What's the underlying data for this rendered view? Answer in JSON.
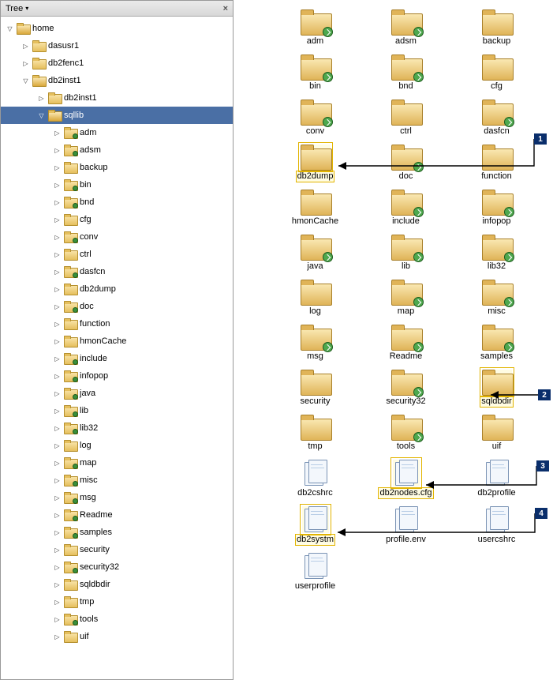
{
  "panel": {
    "title": "Tree"
  },
  "tree": [
    {
      "depth": 0,
      "toggle": "open",
      "folder": "open",
      "label": "home"
    },
    {
      "depth": 1,
      "toggle": "closed",
      "folder": "closed",
      "label": "dasusr1"
    },
    {
      "depth": 1,
      "toggle": "closed",
      "folder": "closed",
      "label": "db2fenc1"
    },
    {
      "depth": 1,
      "toggle": "open",
      "folder": "open",
      "label": "db2inst1"
    },
    {
      "depth": 2,
      "toggle": "closed",
      "folder": "closed",
      "label": "db2inst1"
    },
    {
      "depth": 2,
      "toggle": "open",
      "folder": "open",
      "label": "sqllib",
      "selected": true
    },
    {
      "depth": 3,
      "toggle": "closed",
      "folder": "closed",
      "link": true,
      "label": "adm"
    },
    {
      "depth": 3,
      "toggle": "closed",
      "folder": "closed",
      "link": true,
      "label": "adsm"
    },
    {
      "depth": 3,
      "toggle": "closed",
      "folder": "closed",
      "label": "backup"
    },
    {
      "depth": 3,
      "toggle": "closed",
      "folder": "closed",
      "link": true,
      "label": "bin"
    },
    {
      "depth": 3,
      "toggle": "closed",
      "folder": "closed",
      "link": true,
      "label": "bnd"
    },
    {
      "depth": 3,
      "toggle": "closed",
      "folder": "closed",
      "label": "cfg"
    },
    {
      "depth": 3,
      "toggle": "closed",
      "folder": "closed",
      "link": true,
      "label": "conv"
    },
    {
      "depth": 3,
      "toggle": "closed",
      "folder": "closed",
      "label": "ctrl"
    },
    {
      "depth": 3,
      "toggle": "closed",
      "folder": "closed",
      "link": true,
      "label": "dasfcn"
    },
    {
      "depth": 3,
      "toggle": "closed",
      "folder": "closed",
      "label": "db2dump"
    },
    {
      "depth": 3,
      "toggle": "closed",
      "folder": "closed",
      "link": true,
      "label": "doc"
    },
    {
      "depth": 3,
      "toggle": "closed",
      "folder": "closed",
      "label": "function"
    },
    {
      "depth": 3,
      "toggle": "closed",
      "folder": "closed",
      "label": "hmonCache"
    },
    {
      "depth": 3,
      "toggle": "closed",
      "folder": "closed",
      "link": true,
      "label": "include"
    },
    {
      "depth": 3,
      "toggle": "closed",
      "folder": "closed",
      "link": true,
      "label": "infopop"
    },
    {
      "depth": 3,
      "toggle": "closed",
      "folder": "closed",
      "link": true,
      "label": "java"
    },
    {
      "depth": 3,
      "toggle": "closed",
      "folder": "closed",
      "link": true,
      "label": "lib"
    },
    {
      "depth": 3,
      "toggle": "closed",
      "folder": "closed",
      "link": true,
      "label": "lib32"
    },
    {
      "depth": 3,
      "toggle": "closed",
      "folder": "closed",
      "label": "log"
    },
    {
      "depth": 3,
      "toggle": "closed",
      "folder": "closed",
      "link": true,
      "label": "map"
    },
    {
      "depth": 3,
      "toggle": "closed",
      "folder": "closed",
      "link": true,
      "label": "misc"
    },
    {
      "depth": 3,
      "toggle": "closed",
      "folder": "closed",
      "link": true,
      "label": "msg"
    },
    {
      "depth": 3,
      "toggle": "closed",
      "folder": "closed",
      "link": true,
      "label": "Readme"
    },
    {
      "depth": 3,
      "toggle": "closed",
      "folder": "closed",
      "link": true,
      "label": "samples"
    },
    {
      "depth": 3,
      "toggle": "closed",
      "folder": "closed",
      "label": "security"
    },
    {
      "depth": 3,
      "toggle": "closed",
      "folder": "closed",
      "link": true,
      "label": "security32"
    },
    {
      "depth": 3,
      "toggle": "closed",
      "folder": "closed",
      "label": "sqldbdir"
    },
    {
      "depth": 3,
      "toggle": "closed",
      "folder": "closed",
      "label": "tmp"
    },
    {
      "depth": 3,
      "toggle": "closed",
      "folder": "closed",
      "link": true,
      "label": "tools"
    },
    {
      "depth": 3,
      "toggle": "closed",
      "folder": "closed",
      "label": "uif"
    }
  ],
  "grid": [
    {
      "type": "folder",
      "link": true,
      "label": "adm"
    },
    {
      "type": "folder",
      "link": true,
      "label": "adsm"
    },
    {
      "type": "folder",
      "link": false,
      "label": "backup"
    },
    {
      "type": "folder",
      "link": true,
      "label": "bin"
    },
    {
      "type": "folder",
      "link": true,
      "label": "bnd"
    },
    {
      "type": "folder",
      "link": false,
      "label": "cfg"
    },
    {
      "type": "folder",
      "link": true,
      "label": "conv"
    },
    {
      "type": "folder",
      "link": false,
      "label": "ctrl"
    },
    {
      "type": "folder",
      "link": true,
      "label": "dasfcn"
    },
    {
      "type": "folder",
      "link": false,
      "label": "db2dump",
      "highlight": true,
      "callout": 1
    },
    {
      "type": "folder",
      "link": true,
      "label": "doc"
    },
    {
      "type": "folder",
      "link": false,
      "label": "function"
    },
    {
      "type": "folder",
      "link": false,
      "label": "hmonCache"
    },
    {
      "type": "folder",
      "link": true,
      "label": "include"
    },
    {
      "type": "folder",
      "link": true,
      "label": "infopop"
    },
    {
      "type": "folder",
      "link": true,
      "label": "java"
    },
    {
      "type": "folder",
      "link": true,
      "label": "lib"
    },
    {
      "type": "folder",
      "link": true,
      "label": "lib32"
    },
    {
      "type": "folder",
      "link": false,
      "label": "log"
    },
    {
      "type": "folder",
      "link": true,
      "label": "map"
    },
    {
      "type": "folder",
      "link": true,
      "label": "misc"
    },
    {
      "type": "folder",
      "link": true,
      "label": "msg"
    },
    {
      "type": "folder",
      "link": true,
      "label": "Readme"
    },
    {
      "type": "folder",
      "link": true,
      "label": "samples"
    },
    {
      "type": "folder",
      "link": false,
      "label": "security"
    },
    {
      "type": "folder",
      "link": true,
      "label": "security32"
    },
    {
      "type": "folder",
      "link": false,
      "label": "sqldbdir",
      "highlight": true,
      "callout": 2
    },
    {
      "type": "folder",
      "link": false,
      "label": "tmp"
    },
    {
      "type": "folder",
      "link": true,
      "label": "tools"
    },
    {
      "type": "folder",
      "link": false,
      "label": "uif"
    },
    {
      "type": "file",
      "label": "db2cshrc"
    },
    {
      "type": "file",
      "label": "db2nodes.cfg",
      "highlight": true,
      "callout": 3
    },
    {
      "type": "file",
      "label": "db2profile"
    },
    {
      "type": "file",
      "label": "db2systm",
      "highlight": true,
      "callout": 4
    },
    {
      "type": "file",
      "label": "profile.env"
    },
    {
      "type": "file",
      "label": "usercshrc"
    },
    {
      "type": "file",
      "label": "userprofile"
    }
  ],
  "callouts": [
    "1",
    "2",
    "3",
    "4"
  ]
}
